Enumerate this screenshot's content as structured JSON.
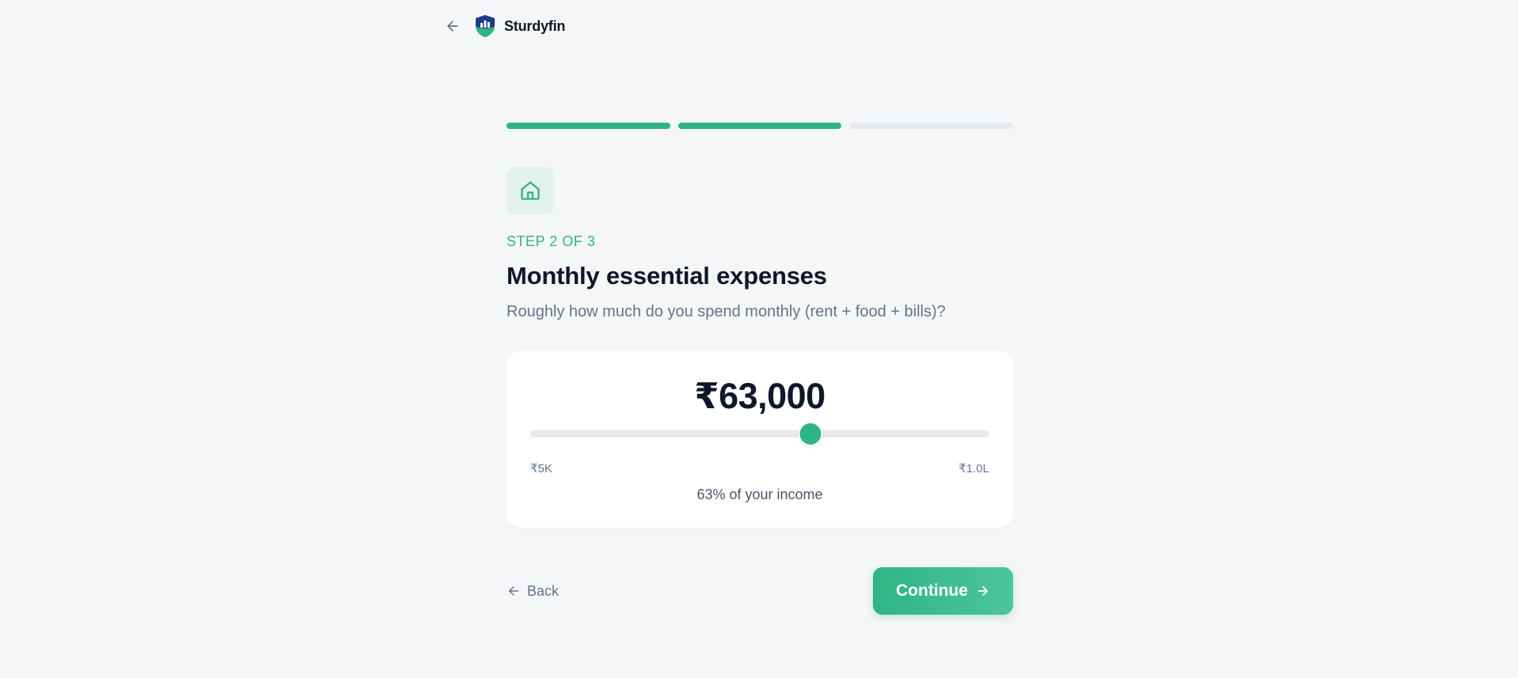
{
  "brand": {
    "name": "Sturdyfin",
    "logo_icon": "shield-chart-logo"
  },
  "progress": {
    "total_steps": 3,
    "completed_segments": 2
  },
  "step": {
    "icon": "home-icon",
    "label": "STEP 2 OF 3"
  },
  "title": "Monthly essential expenses",
  "subtitle": "Roughly how much do you spend monthly (rent + food + bills)?",
  "slider": {
    "amount": "₹63,000",
    "value": 63000,
    "min": 5000,
    "max": 100000,
    "min_label": "₹5K",
    "max_label": "₹1.0L",
    "income_note": "63% of your income"
  },
  "actions": {
    "back_label": "Back",
    "continue_label": "Continue"
  },
  "colors": {
    "accent": "#2fb585",
    "text": "#0f172a",
    "muted": "#64748b",
    "background": "#f5f6f8"
  }
}
